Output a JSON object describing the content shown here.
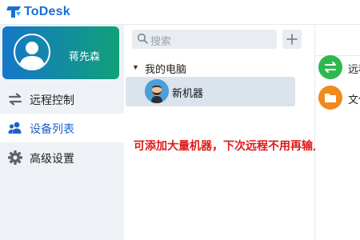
{
  "app": {
    "title": "ToDesk"
  },
  "user": {
    "name": "蒋先森"
  },
  "nav": {
    "items": [
      {
        "label": "远程控制",
        "icon": "transfer-arrows-icon"
      },
      {
        "label": "设备列表",
        "icon": "users-icon",
        "active": true
      },
      {
        "label": "高级设置",
        "icon": "gear-icon"
      }
    ]
  },
  "device_list": {
    "search_placeholder": "搜索",
    "group_label": "我的电脑",
    "machines": [
      {
        "name": "新机器"
      }
    ]
  },
  "annotation": {
    "text": "可添加大量机器，下次远程不用再输入远程码"
  },
  "actions": [
    {
      "label": "远程",
      "icon": "swap-arrows-icon",
      "color": "#2fb84f"
    },
    {
      "label": "文件",
      "icon": "folder-icon",
      "color": "#f08a1c"
    }
  ],
  "colors": {
    "brand": "#1a6fd6",
    "note": "#e01818"
  }
}
